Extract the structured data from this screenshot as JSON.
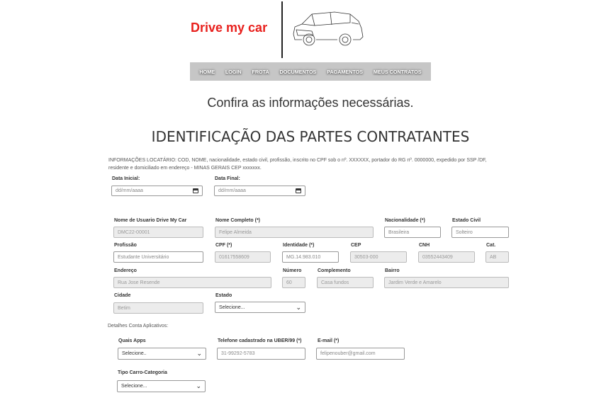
{
  "header": {
    "brand": "Drive my car",
    "car_image": "car-sketch-icon"
  },
  "nav": {
    "items": [
      "HOME",
      "LOGIN",
      "FROTA",
      "DOCUMENTOS",
      "PAGAMENTOS",
      "MEUS CONTRATOS"
    ]
  },
  "main": {
    "subtitle": "Confira as informações necessárias.",
    "heading": "IDENTIFICAÇÃO DAS PARTES CONTRATANTES",
    "info_text": "INFORMAÇÕES LOCATÁRIO: COD, NOME, nacionalidade, estado civil, profissão, inscrito no CPF sob o nº. XXXXXX, portador do RG nº. 0000000, expedido por SSP /DF, residente e domiciliado em endereço  - MINAS GERAIS CEP xxxxxxx."
  },
  "dates": {
    "start": {
      "label": "Data Inicial:",
      "placeholder": "dd/mm/aaaa"
    },
    "end": {
      "label": "Data Final:",
      "placeholder": "dd/mm/aaaa"
    }
  },
  "form": {
    "usuario": {
      "label": "Nome de Usuario Drive My Car",
      "value": "DMC22-00001"
    },
    "nome": {
      "label": "Nome Completo (*)",
      "value": "Felipe Almeida"
    },
    "nacionalidade": {
      "label": "Nacionalidade (*)",
      "value": "Brasileira"
    },
    "estado_civil": {
      "label": "Estado Civil",
      "value": "Solteiro"
    },
    "profissao": {
      "label": "Profissão",
      "value": "Estudante Universitário"
    },
    "cpf": {
      "label": "CPF (*)",
      "value": "01617558609"
    },
    "identidade": {
      "label": "Identidade (*)",
      "value": "MG.14.983.010"
    },
    "cep": {
      "label": "CEP",
      "value": "30503-000"
    },
    "cnh": {
      "label": "CNH",
      "value": "03552443409"
    },
    "cat": {
      "label": "Cat.",
      "value": "AB"
    },
    "endereco": {
      "label": "Endereço",
      "value": "Rua Jose Resende"
    },
    "numero": {
      "label": "Número",
      "value": "60"
    },
    "complemento": {
      "label": "Complemento",
      "value": "Casa fundos"
    },
    "bairro": {
      "label": "Bairro",
      "value": "Jardim Verde e Amarelo"
    },
    "cidade": {
      "label": "Cidade",
      "value": "Betim"
    },
    "estado": {
      "label": "Estado",
      "value": "Selecione..."
    }
  },
  "apps": {
    "section_label": "Detalhes Conta Aplicativos:",
    "quais_apps": {
      "label": "Quais Apps",
      "value": "Selecione.."
    },
    "telefone": {
      "label": "Telefone cadastrado na UBER/99 (*)",
      "value": "31-99292-5783"
    },
    "email": {
      "label": "E-mail (*)",
      "value": "felipenouber@gmail.com"
    },
    "tipo_carro": {
      "label": "Tipo Carro-Categoria",
      "value": "Selecione..."
    }
  }
}
